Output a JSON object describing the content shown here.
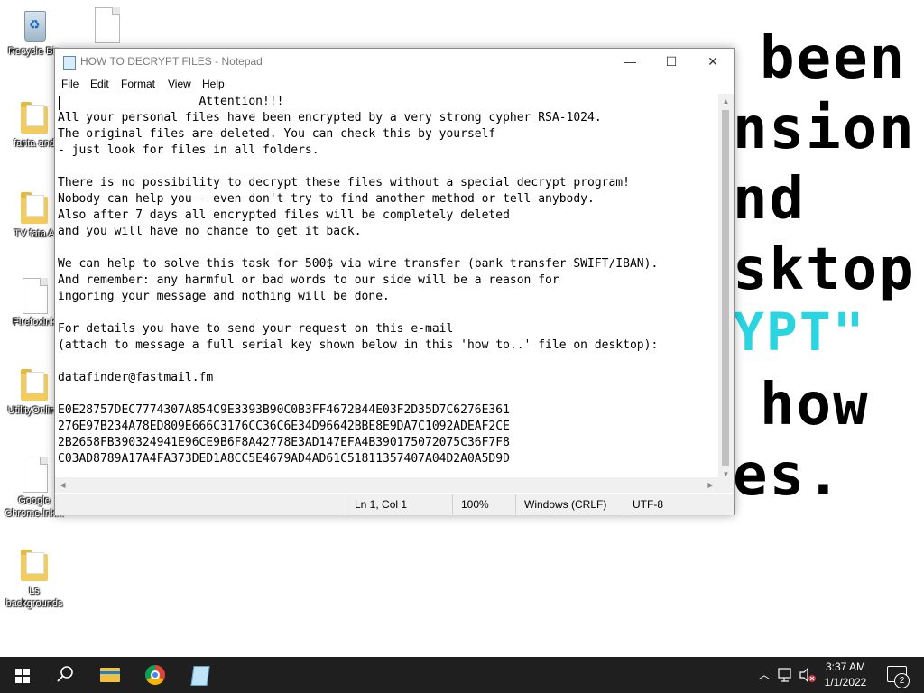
{
  "wallpaper": {
    "lines": [
      "been",
      "nsion",
      "nd",
      "sktop",
      "YPT\"",
      "how",
      "es."
    ],
    "accent_color": "#2ad4e0"
  },
  "desktop_icons": [
    {
      "label": "Recycle Bin",
      "icon": "recycle-bin-icon"
    },
    {
      "label": "fanta and",
      "icon": "folder-icon"
    },
    {
      "label": "TV fata A",
      "icon": "folder-icon"
    },
    {
      "label": "Firefoxlnk",
      "icon": "file-icon"
    },
    {
      "label": "UtilityOnline",
      "icon": "folder-icon"
    },
    {
      "label": "Google Chrome.lnk...",
      "icon": "file-icon"
    },
    {
      "label": "Ls backgrounds",
      "icon": "folder-icon"
    }
  ],
  "notepad": {
    "title": "HOW TO DECRYPT FILES - Notepad",
    "menu": [
      "File",
      "Edit",
      "Format",
      "View",
      "Help"
    ],
    "controls": {
      "minimize": "—",
      "maximize": "☐",
      "close": "✕"
    },
    "content": "                    Attention!!!\nAll your personal files have been encrypted by a very strong cypher RSA-1024.\nThe original files are deleted. You can check this by yourself\n- just look for files in all folders.\n\nThere is no possibility to decrypt these files without a special decrypt program!\nNobody can help you - even don't try to find another method or tell anybody.\nAlso after 7 days all encrypted files will be completely deleted\nand you will have no chance to get it back.\n\nWe can help to solve this task for 500$ via wire transfer (bank transfer SWIFT/IBAN).\nAnd remember: any harmful or bad words to our side will be a reason for\ningoring your message and nothing will be done.\n\nFor details you have to send your request on this e-mail\n(attach to message a full serial key shown below in this 'how to..' file on desktop):\n\ndatafinder@fastmail.fm\n\nE0E28757DEC7774307A854C9E3393B90C0B3FF4672B44E03F2D35D7C6276E361\n276E97B234A78ED809E666C3176CC36C6E34D96642BBE8E9DA7C1092ADEAF2CE\n2B2658FB390324941E96CE9B6F8A42778E3AD147EFA4B390175072075C36F7F8\nC03AD8789A17A4FA373DED1A8CC5E4679AD4AD61C51811357407A04D2A0A5D9D",
    "status": {
      "position": "Ln 1, Col 1",
      "zoom": "100%",
      "line_ending": "Windows (CRLF)",
      "encoding": "UTF-8"
    }
  },
  "taskbar": {
    "items": [
      "start-button",
      "search-icon",
      "file-explorer-icon",
      "chrome-icon",
      "notepad-icon"
    ],
    "clock": {
      "time": "3:37 AM",
      "date": "1/1/2022"
    },
    "notifications": "2"
  }
}
